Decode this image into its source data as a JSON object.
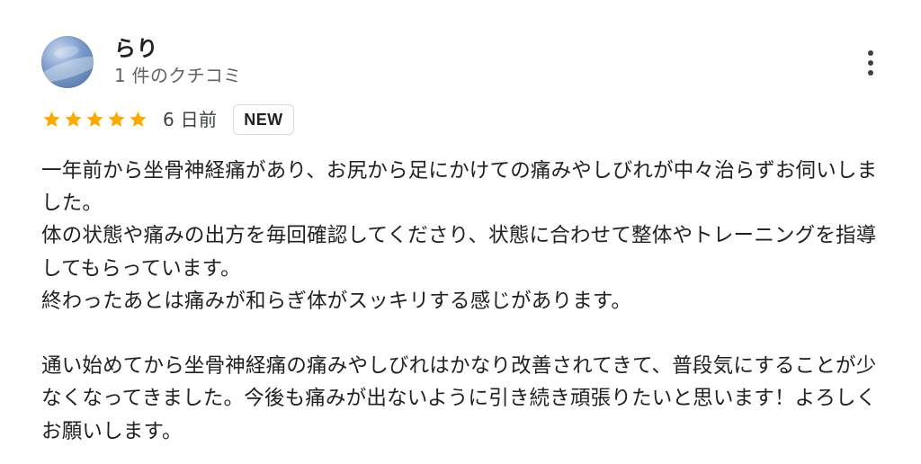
{
  "reviewer": {
    "name": "らり",
    "review_count": "1 件のクチコミ",
    "avatar_icon": "user-avatar"
  },
  "rating": {
    "stars": 5,
    "max_stars": 5,
    "star_color": "#f9ab00",
    "star_icon": "star-icon"
  },
  "date": "6 日前",
  "badge": "NEW",
  "menu": {
    "icon": "more-vert-icon"
  },
  "body": {
    "line1": "一年前から坐骨神経痛があり、お尻から足にかけての痛みやしびれが中々治らずお伺いしました。",
    "line2": "体の状態や痛みの出方を毎回確認してくださり、状態に合わせて整体やトレーニングを指導してもらっています。",
    "line3": "終わったあとは痛みが和らぎ体がスッキリする感じがあります。",
    "line4": "通い始めてから坐骨神経痛の痛みやしびれはかなり改善されてきて、普段気にすることが少なくなってきました。今後も痛みが出ないように引き続き頑張りたいと思います！よろしくお願いします。"
  }
}
